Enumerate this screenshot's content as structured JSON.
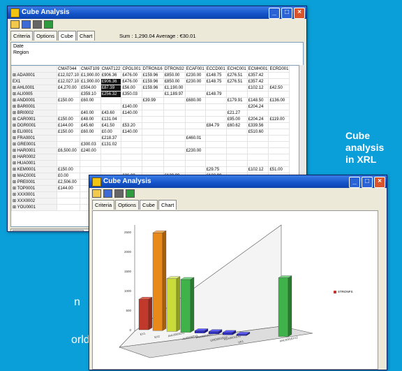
{
  "background_color": "#0a9fd8",
  "caption": {
    "line1": "Cube analysis",
    "line2": "in XRL"
  },
  "background_text": {
    "fragment1": "n",
    "fragment2": "orldwide."
  },
  "window_main": {
    "title": "Cube Analysis",
    "tabs": [
      "Criteria",
      "Options",
      "Cube",
      "Chart"
    ],
    "status": "Sum : 1,290.04  Average : €30.01",
    "filters": [
      "Date",
      "Region"
    ],
    "columns": [
      "CMAT044",
      "CMAT109",
      "CMAT122",
      "CPOL001",
      "DTRON16",
      "DTRON32",
      "ECAF001",
      "ECCD001",
      "ECHC001",
      "ECMH001",
      "ECRD001"
    ],
    "rows": [
      {
        "code": "ADA0001",
        "cells": [
          "£12,027.10",
          "£1,900.00",
          "£906.36",
          "£476.00",
          "£159.96",
          "£850.00",
          "£230.00",
          "£148.75",
          "£276.51",
          "£357.42",
          ""
        ]
      },
      {
        "code": "EX1",
        "cells": [
          "£12,027.10",
          "£1,900.00",
          "£906.36",
          "£476.00",
          "£159.96",
          "£850.00",
          "£230.00",
          "£148.75",
          "£276.51",
          "£357.42",
          ""
        ]
      },
      {
        "code": "AHL0001",
        "cells": [
          "£4,270.00",
          "£504.00",
          "£87.39",
          "£56.00",
          "£159.96",
          "£1,190.00",
          "",
          "",
          "",
          "£102.12",
          "£42.50"
        ]
      },
      {
        "code": "ALI0005",
        "cells": [
          "",
          "£359.10",
          "£256.32",
          "£350.03",
          "",
          "£1,189.97",
          "",
          "£148.79",
          "",
          "",
          ""
        ]
      },
      {
        "code": "AND0001",
        "cells": [
          "£150.00",
          "£60.00",
          "",
          "",
          "£39.99",
          "",
          "£680.00",
          "",
          "£179.91",
          "£148.50",
          "£136.00"
        ]
      },
      {
        "code": "BAR0001",
        "cells": [
          "",
          "",
          "",
          "£140.00",
          "",
          "",
          "",
          "",
          "",
          "£204.24",
          ""
        ]
      },
      {
        "code": "BRI0002",
        "cells": [
          "",
          "£40.00",
          "£43.60",
          "£140.00",
          "",
          "",
          "",
          "",
          "£21.27",
          "",
          ""
        ]
      },
      {
        "code": "CAR0001",
        "cells": [
          "£150.00",
          "£48.00",
          "£131.04",
          "",
          "",
          "",
          "",
          "",
          "£95.00",
          "£204.24",
          "£119.00"
        ]
      },
      {
        "code": "DGR0001",
        "cells": [
          "£144.00",
          "£45.60",
          "£41.50",
          "£53.20",
          "",
          "",
          "",
          "£84.79",
          "£60.62",
          "£339.56",
          ""
        ]
      },
      {
        "code": "ELI0001",
        "cells": [
          "£150.00",
          "£60.00",
          "£0.00",
          "£140.00",
          "",
          "",
          "",
          "",
          "",
          "£510.60",
          ""
        ]
      },
      {
        "code": "FRA0001",
        "cells": [
          "",
          "",
          "£218.37",
          "",
          "",
          "",
          "£460.01",
          "",
          "",
          "",
          ""
        ]
      },
      {
        "code": "GRE0001",
        "cells": [
          "",
          "£300.03",
          "£131.02",
          "",
          "",
          "",
          "",
          "",
          "",
          "",
          ""
        ]
      },
      {
        "code": "HAR0001",
        "cells": [
          "£6,500.00",
          "£240.00",
          "",
          "",
          "",
          "",
          "£230.00",
          "",
          "",
          "",
          ""
        ]
      },
      {
        "code": "HAR0002",
        "cells": [
          "",
          "",
          "",
          "",
          "",
          "",
          "",
          "",
          "",
          "",
          ""
        ]
      },
      {
        "code": "HUA0001",
        "cells": [
          "",
          "",
          "",
          "",
          "",
          "",
          "",
          "",
          "",
          "",
          ""
        ]
      },
      {
        "code": "KEM0001",
        "cells": [
          "£150.00",
          "",
          "",
          "",
          "",
          "",
          "",
          "£29.75",
          "",
          "£102.12",
          "£51.00"
        ]
      },
      {
        "code": "MAC0001",
        "cells": [
          "£0.00",
          "",
          "",
          "£26.00",
          "",
          "£120.00",
          "",
          "£122.90",
          "",
          "",
          ""
        ]
      },
      {
        "code": "PRE0001",
        "cells": [
          "£2,506.00",
          "",
          "",
          "",
          "",
          "",
          "",
          "",
          "",
          "",
          ""
        ]
      },
      {
        "code": "TOP0001",
        "cells": [
          "£144.00",
          "",
          "",
          "",
          "",
          "",
          "",
          "",
          "",
          "",
          ""
        ]
      },
      {
        "code": "XXX0001",
        "cells": [
          "",
          "",
          "",
          "",
          "",
          "",
          "",
          "",
          "",
          "",
          ""
        ]
      },
      {
        "code": "XXX0002",
        "cells": [
          "",
          "",
          "",
          "",
          "",
          "",
          "",
          "",
          "",
          "",
          ""
        ]
      },
      {
        "code": "YOU0001",
        "cells": [
          "",
          "",
          "",
          "",
          "",
          "",
          "",
          "",
          "",
          "",
          ""
        ]
      }
    ]
  },
  "window_chart": {
    "title": "Cube Analysis",
    "tabs": [
      "Criteria",
      "Options",
      "Cube",
      "Chart"
    ],
    "legend_label": "STRONFS",
    "y_ticks": [
      "2500",
      "2000",
      "1500",
      "1000",
      "500",
      "0"
    ],
    "bars": [
      {
        "label": "EX1",
        "value": 780,
        "color": "#c0392b",
        "side": "#8e2a20",
        "top": "#e06050"
      },
      {
        "label": "EX2",
        "value": 2500,
        "color": "#e8891a",
        "side": "#a85f0d",
        "top": "#f3b060"
      },
      {
        "label": "AHL0001EX2",
        "value": 1350,
        "color": "#c9dc3a",
        "side": "#8fa022",
        "top": "#e2ee80"
      },
      {
        "label": "ALI0005EX2",
        "value": 1350,
        "color": "#3fb24a",
        "side": "#2a7a32",
        "top": "#7ad383"
      },
      {
        "label": "FRA0001EX2",
        "value": 60,
        "color": "#2d2dbf",
        "side": "#1c1c80",
        "top": "#5a5aff"
      },
      {
        "label": "GRE0001EX2",
        "value": 60,
        "color": "#2d2dbf",
        "side": "#1c1c80",
        "top": "#5a5aff"
      },
      {
        "label": "HUA0001EX2",
        "value": 60,
        "color": "#2d2dbf",
        "side": "#1c1c80",
        "top": "#5a5aff"
      },
      {
        "label": "UK1",
        "value": 0,
        "color": "#2d2dbf",
        "side": "#1c1c80",
        "top": "#5a5aff"
      },
      {
        "label": "AHL0001EX12",
        "value": 1500,
        "color": "#3fb24a",
        "side": "#2a7a32",
        "top": "#7ad383"
      }
    ]
  }
}
